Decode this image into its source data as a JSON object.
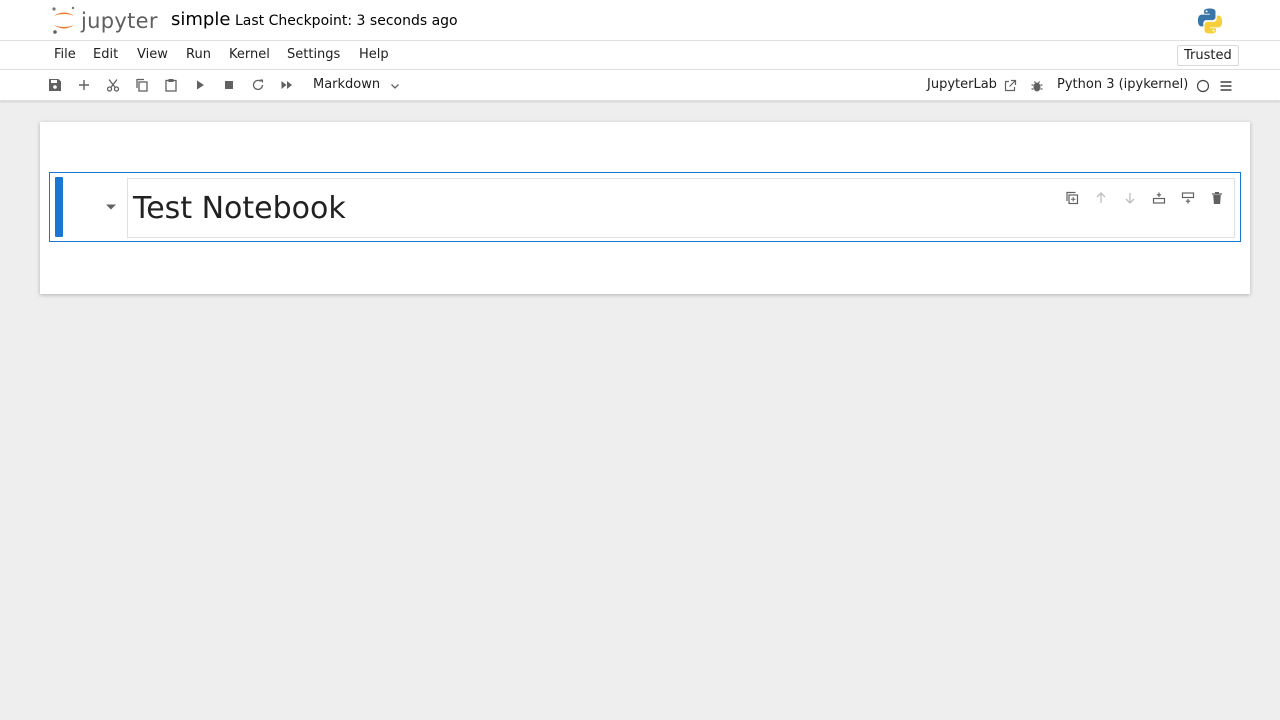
{
  "header": {
    "logo_text": "jupyter",
    "notebook_name": "simple",
    "checkpoint": "Last Checkpoint: 3 seconds ago"
  },
  "menubar": {
    "items": [
      "File",
      "Edit",
      "View",
      "Run",
      "Kernel",
      "Settings",
      "Help"
    ],
    "trusted": "Trusted"
  },
  "toolbar": {
    "cell_type": "Markdown",
    "jupyterlab_link": "JupyterLab",
    "kernel": "Python 3 (ipykernel)"
  },
  "cell": {
    "heading": "Test Notebook"
  },
  "colors": {
    "accent": "#1976d2",
    "logo_orange": "#f37726",
    "background": "#eeeeee"
  }
}
